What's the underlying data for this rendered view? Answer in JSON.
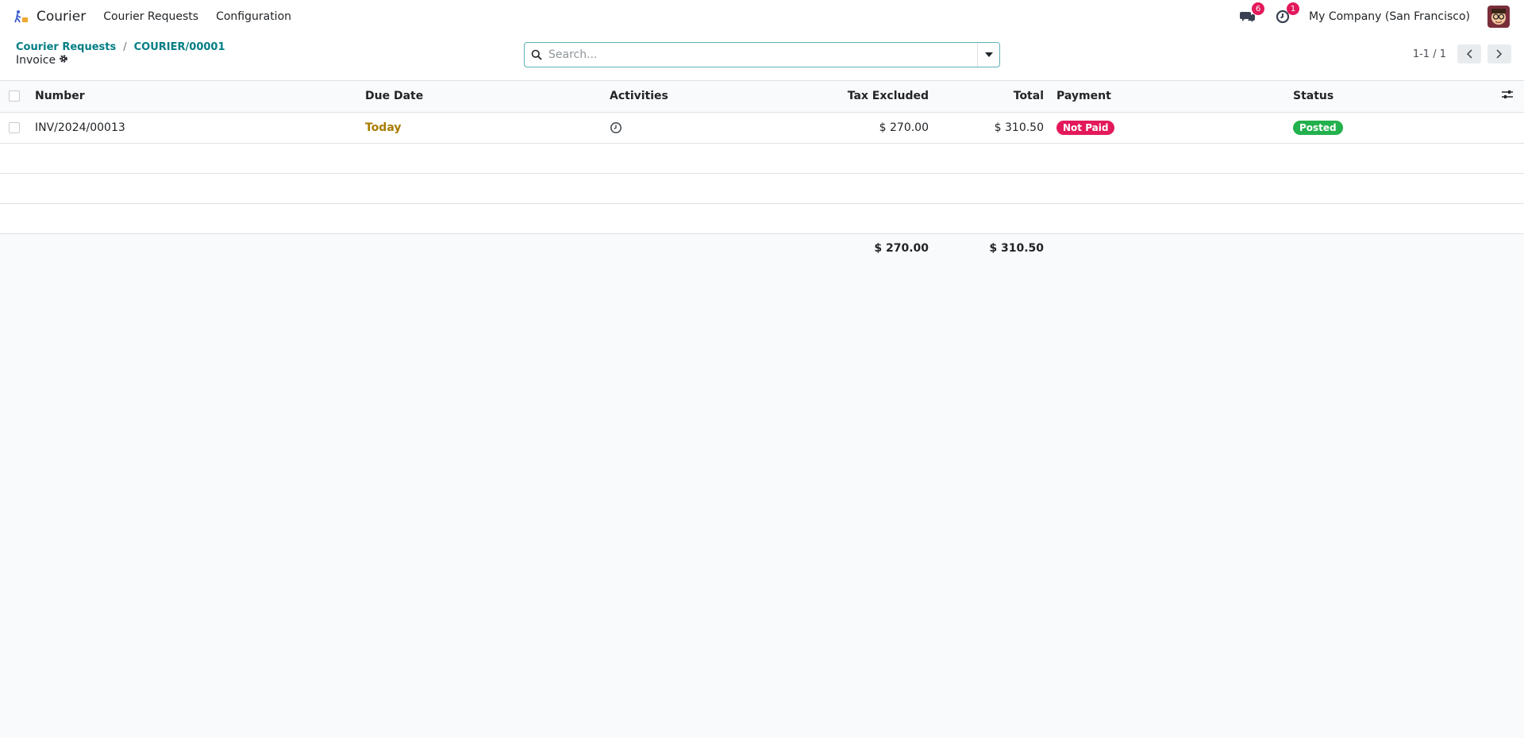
{
  "navbar": {
    "app_name": "Courier",
    "menu": [
      "Courier Requests",
      "Configuration"
    ],
    "messages_count": "6",
    "activities_count": "1",
    "company": "My Company (San Francisco)"
  },
  "control_panel": {
    "breadcrumb": [
      "Courier Requests",
      "COURIER/00001"
    ],
    "title": "Invoice",
    "search_placeholder": "Search...",
    "pager": "1-1 / 1"
  },
  "table": {
    "columns": {
      "number": "Number",
      "due_date": "Due Date",
      "activities": "Activities",
      "tax_excluded": "Tax Excluded",
      "total": "Total",
      "payment": "Payment",
      "status": "Status"
    },
    "rows": [
      {
        "number": "INV/2024/00013",
        "due_date": "Today",
        "tax_excluded": "$ 270.00",
        "total": "$ 310.50",
        "payment": "Not Paid",
        "status": "Posted"
      }
    ],
    "totals": {
      "tax_excluded": "$ 270.00",
      "total": "$ 310.50"
    }
  },
  "colors": {
    "accent": "#017e84",
    "badge": "#e3195b",
    "posted": "#22b14c",
    "due_today": "#a87b00"
  }
}
